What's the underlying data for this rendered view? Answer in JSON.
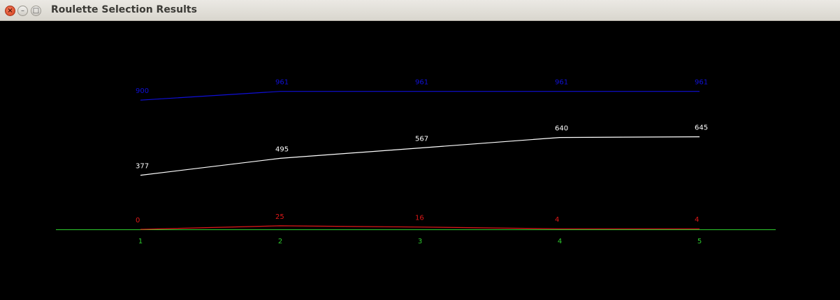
{
  "window": {
    "title": "Roulette Selection Results",
    "close_glyph": "×",
    "minimize_glyph": "–",
    "maximize_glyph": "□"
  },
  "chart_data": {
    "type": "line",
    "x": [
      1,
      2,
      3,
      4,
      5
    ],
    "tick_labels": [
      "1",
      "2",
      "3",
      "4",
      "5"
    ],
    "series": [
      {
        "values": [
          900,
          961,
          961,
          961,
          961
        ],
        "color": "#1010d8",
        "labels": [
          "900",
          "961",
          "961",
          "961",
          "961"
        ]
      },
      {
        "values": [
          377,
          495,
          567,
          640,
          645
        ],
        "color": "#ffffff",
        "labels": [
          "377",
          "495",
          "567",
          "640",
          "645"
        ]
      },
      {
        "values": [
          0,
          25,
          16,
          4,
          4
        ],
        "color": "#e01818",
        "labels": [
          "0",
          "25",
          "16",
          "4",
          "4"
        ]
      }
    ],
    "baseline_color": "#2ecc2e",
    "tick_color": "#2ecc2e",
    "grid": false,
    "legend": "none",
    "ylim": [
      0,
      961
    ]
  }
}
